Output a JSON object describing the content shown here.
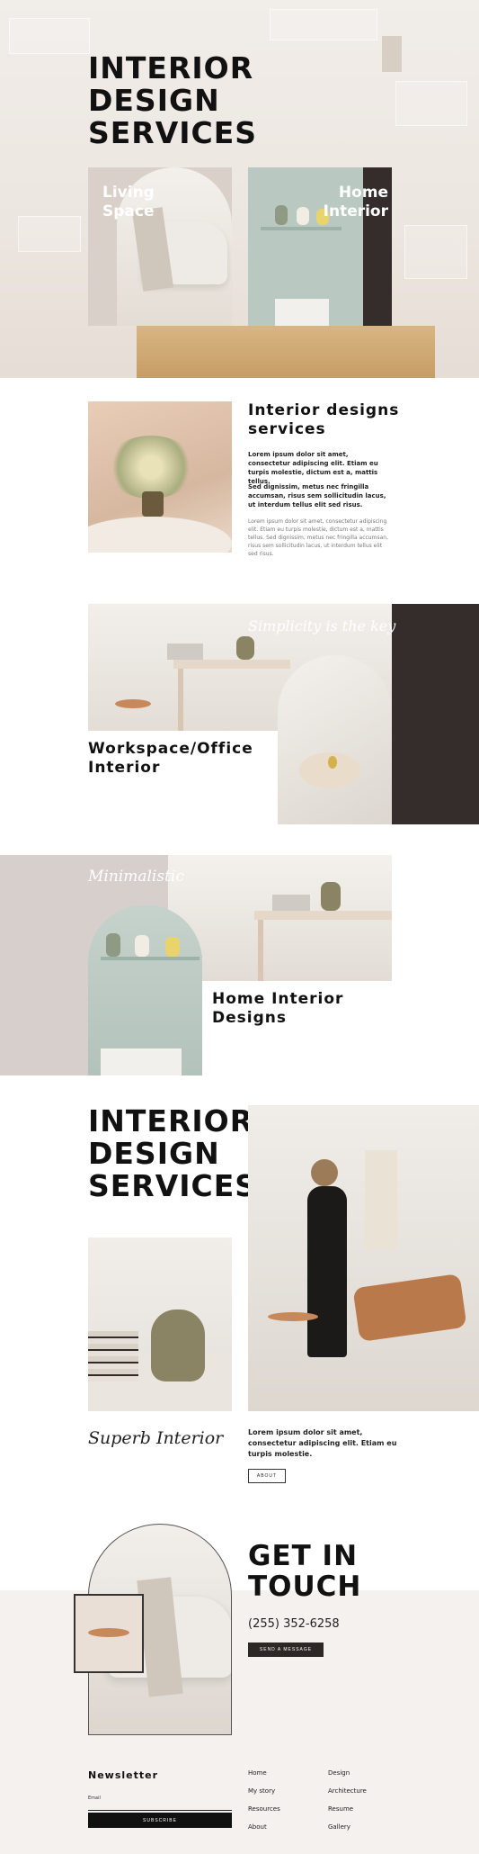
{
  "hero": {
    "title": "INTERIOR DESIGN SERVICES",
    "cards": [
      {
        "label": "Living Space"
      },
      {
        "label": "Home Interior"
      }
    ]
  },
  "designs": {
    "title": "Interior designs services",
    "para1": "Lorem ipsum dolor sit amet, consectetur adipiscing elit. Etiam eu turpis molestie, dictum est a, mattis tellus.",
    "para2": "Sed dignissim, metus nec fringilla accumsan, risus sem sollicitudin lacus, ut interdum tellus elit sed risus.",
    "para3": "Lorem ipsum dolor sit amet, consectetur adipiscing elit. Etiam eu turpis molestie, dictum est a, mattis tellus. Sed dignissim, metus nec fringilla accumsan, risus sem sollicitudin lacus, ut interdum tellus elit sed risus."
  },
  "workspace": {
    "script": "Simplicity is the key",
    "title": "Workspace/Office Interior"
  },
  "minimal": {
    "script": "Minimalistic",
    "title": "Home Interior Designs"
  },
  "services2": {
    "title": "INTERIOR DESIGN SERVICES",
    "script": "Superb Interior",
    "text": "Lorem ipsum dolor sit amet, consectetur adipiscing elit. Etiam eu turpis molestie.",
    "about_label": "ABOUT"
  },
  "contact": {
    "title": "GET IN TOUCH",
    "phone": "(255) 352-6258",
    "message_label": "SEND A MESSAGE"
  },
  "footer": {
    "newsletter_title": "Newsletter",
    "email_label": "Email",
    "subscribe_label": "SUBSCRIBE",
    "links_col1": [
      "Home",
      "My story",
      "Resources",
      "About"
    ],
    "links_col2": [
      "Design",
      "Architecture",
      "Resume",
      "Gallery"
    ]
  },
  "colors": {
    "dark": "#352d2b",
    "sage": "#b9c8c1",
    "blush": "#d7cfcb",
    "sand": "#f5f1ee"
  }
}
